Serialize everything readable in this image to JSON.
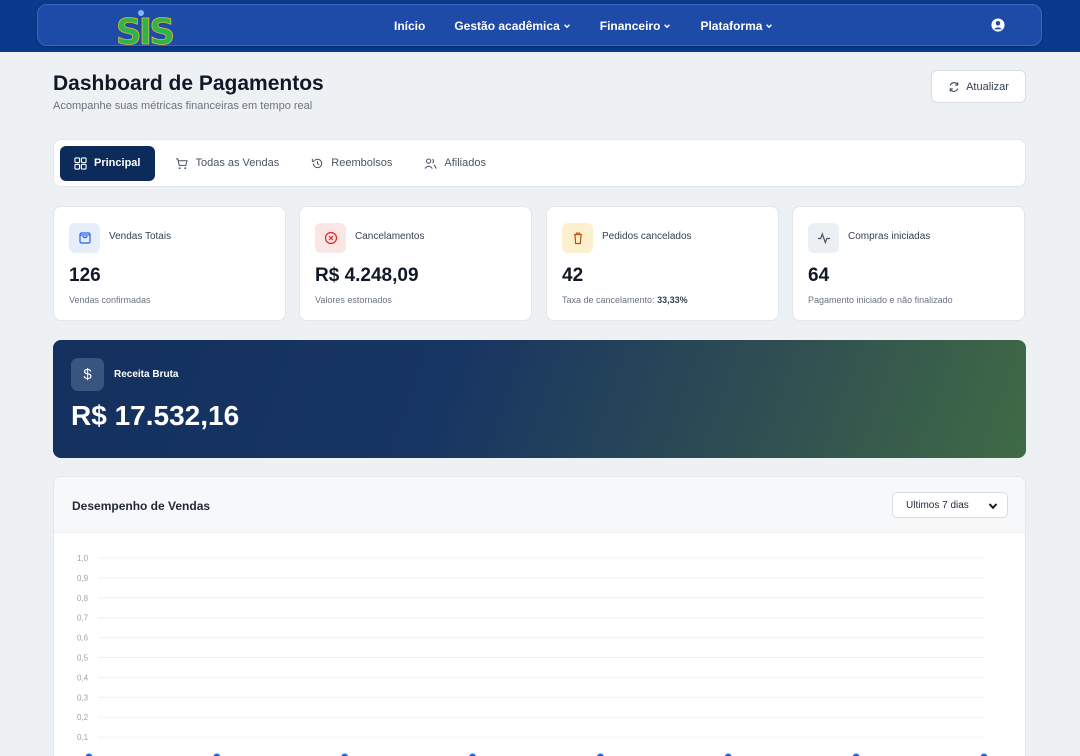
{
  "nav": {
    "logo_text": "SIS",
    "links": [
      {
        "label": "Início",
        "dropdown": false
      },
      {
        "label": "Gestão acadêmica",
        "dropdown": true
      },
      {
        "label": "Financeiro",
        "dropdown": true
      },
      {
        "label": "Plataforma",
        "dropdown": true
      }
    ],
    "user_icon": "user-circle-icon"
  },
  "header": {
    "title": "Dashboard de Pagamentos",
    "subtitle": "Acompanhe suas métricas financeiras em tempo real",
    "refresh_label": "Atualizar"
  },
  "tabs": [
    {
      "label": "Principal",
      "icon": "grid-icon",
      "active": true
    },
    {
      "label": "Todas as Vendas",
      "icon": "cart-icon",
      "active": false
    },
    {
      "label": "Reembolsos",
      "icon": "history-icon",
      "active": false
    },
    {
      "label": "Afiliados",
      "icon": "users-icon",
      "active": false
    }
  ],
  "stats": [
    {
      "title": "Vendas Totais",
      "value": "126",
      "sub": "Vendas confirmadas",
      "icon": "shopping-bag-icon",
      "color": "#2563eb",
      "bg": "#e6edfb"
    },
    {
      "title": "Cancelamentos",
      "value": "R$ 4.248,09",
      "sub": "Valores estornados",
      "icon": "x-circle-icon",
      "color": "#dc2626",
      "bg": "#fbe5e5"
    },
    {
      "title": "Pedidos cancelados",
      "value": "42",
      "sub_prefix": "Taxa de cancelamento: ",
      "sub_bold": "33,33%",
      "icon": "trash-icon",
      "color": "#b45309",
      "bg": "#fdf0cf"
    },
    {
      "title": "Compras iniciadas",
      "value": "64",
      "sub": "Pagamento iniciado e não finalizado",
      "icon": "activity-icon",
      "color": "#4b5563",
      "bg": "#edf0f3"
    }
  ],
  "revenue": {
    "label": "Receita Bruta",
    "value": "R$ 17.532,16",
    "icon_glyph": "$"
  },
  "chart": {
    "title": "Desempenho de Vendas",
    "period_selected": "Ultimos 7 dias"
  },
  "chart_data": {
    "type": "line",
    "title": "Desempenho de Vendas",
    "xlabel": "",
    "ylabel": "",
    "ylim": [
      0,
      1.0
    ],
    "y_ticks": [
      "1,0",
      "0,9",
      "0,8",
      "0,7",
      "0,6",
      "0,5",
      "0,4",
      "0,3",
      "0,2",
      "0,1"
    ],
    "grid": true,
    "series": [
      {
        "values": [
          0,
          0,
          0,
          0,
          0,
          0,
          0,
          0
        ]
      }
    ],
    "colors": {
      "line": "#2563eb",
      "grid": "#eef0f3",
      "tick": "#9ca3af"
    }
  }
}
